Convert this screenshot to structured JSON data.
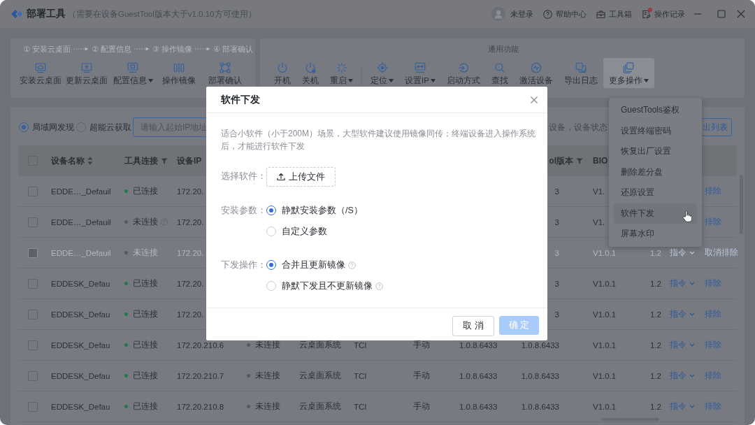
{
  "title_bar": {
    "app_name": "部署工具",
    "note": "（需要在设备GuestTool版本大于v1.0.10方可使用）",
    "user": "未登录",
    "links": [
      {
        "kind": "help",
        "label": "帮助中心",
        "unread": false
      },
      {
        "kind": "toolbox",
        "label": "工具箱",
        "unread": false
      },
      {
        "kind": "log",
        "label": "操作记录",
        "unread": true
      }
    ]
  },
  "deploy": {
    "steps": [
      "① 安装云桌面",
      "② 配置信息",
      "③ 操作镜像",
      "④ 部署确认"
    ],
    "tools": [
      {
        "kind": "install",
        "label": "安装云桌面",
        "dropdown": false
      },
      {
        "kind": "update",
        "label": "更新云桌面",
        "dropdown": false
      },
      {
        "kind": "config",
        "label": "配置信息",
        "dropdown": true
      },
      {
        "kind": "image",
        "label": "操作镜像",
        "dropdown": false
      },
      {
        "kind": "confirm",
        "label": "部署确认",
        "dropdown": false
      }
    ]
  },
  "general": {
    "title": "通用功能",
    "groups": [
      {
        "tools": [
          {
            "kind": "power_on",
            "label": "开机",
            "dropdown": false,
            "expanded": false
          },
          {
            "kind": "power_off",
            "label": "关机",
            "dropdown": false,
            "expanded": false
          },
          {
            "kind": "restart",
            "label": "重启",
            "dropdown": true,
            "expanded": false
          }
        ]
      },
      {
        "tools": [
          {
            "kind": "locate",
            "label": "定位",
            "dropdown": true,
            "expanded": false
          },
          {
            "kind": "ip",
            "label": "设置IP",
            "dropdown": true,
            "expanded": false
          },
          {
            "kind": "boot",
            "label": "启动方式",
            "dropdown": false,
            "expanded": false
          },
          {
            "kind": "find",
            "label": "查找",
            "dropdown": false,
            "expanded": false
          },
          {
            "kind": "activate",
            "label": "激活设备",
            "dropdown": false,
            "expanded": false
          },
          {
            "kind": "export",
            "label": "导出日志",
            "dropdown": false,
            "expanded": false
          },
          {
            "kind": "more",
            "label": "更多操作",
            "dropdown": true,
            "expanded": true
          }
        ]
      }
    ]
  },
  "discovery": {
    "modes": [
      {
        "label": "局域网发现",
        "selected": true
      },
      {
        "label": "超能云获取",
        "selected": false
      }
    ],
    "ip_start": {
      "placeholder": "请输入起始IP地址"
    },
    "hint": "设备，设备状态",
    "export_button": "出列表"
  },
  "table": {
    "select_all": {
      "checked": false
    },
    "columns": {
      "device_name": {
        "label": "设备名称",
        "kind": "sort"
      },
      "tool_connection": {
        "label": "工具连接",
        "kind": "filter"
      },
      "device_ip": {
        "label": "设备IP"
      },
      "column_10": {
        "label": "ol版本",
        "kind": "filter"
      },
      "column_11": {
        "label": "BIO"
      }
    },
    "rows": [
      {
        "checked": false,
        "disabled": false,
        "device_name": "EDDE…_Defauil",
        "tool_connection": {
          "status": "已连接",
          "connected": true,
          "help": false
        },
        "device_ip": "172.20.",
        "column_10": "3",
        "column_11": "V1.",
        "column_14": "排除"
      },
      {
        "checked": false,
        "disabled": false,
        "device_name": "EDDE…_Defauil",
        "tool_connection": {
          "status": "未连接",
          "connected": false,
          "help": true
        },
        "device_ip": "172.20.",
        "column_10": "3",
        "column_11": "V1.",
        "column_14": "排除"
      },
      {
        "checked": false,
        "disabled": true,
        "device_name": "EDDE…_Defauil",
        "tool_connection": {
          "status": "未连接",
          "connected": false,
          "help": false
        },
        "device_ip": "172.20.",
        "column_10": "3",
        "column_11": "V1.0.1",
        "column_12": "1.2",
        "column_13": "指令",
        "column_14": "取消排除"
      },
      {
        "checked": false,
        "disabled": false,
        "device_name": "EDDESK_Defau",
        "tool_connection": {
          "status": "已连接",
          "connected": true,
          "help": false
        },
        "device_ip": "172.20.",
        "column_10": "3",
        "column_11": "V1.0.1",
        "column_12": "1.2",
        "column_13": "指令",
        "column_14": "排除"
      },
      {
        "checked": false,
        "disabled": false,
        "device_name": "EDDESK_Defau",
        "tool_connection": {
          "status": "已连接",
          "connected": true,
          "help": false
        },
        "device_ip": "172.20.",
        "column_10": "3",
        "column_11": "V1.0.1",
        "column_12": "1.2",
        "column_13": "指令",
        "column_14": "排除"
      },
      {
        "checked": false,
        "disabled": false,
        "device_name": "EDDESK_Defau",
        "tool_connection": {
          "status": "已连接",
          "connected": true,
          "help": false
        },
        "device_ip": "172.20.210.6",
        "column_5": {
          "status": "未连接",
          "connected": false,
          "help": false
        },
        "column_6": "云桌面系统",
        "column_7": "TCI",
        "column_8": "手动",
        "column_9": "1.0.8.6433",
        "column_10": "1.0.8.6433",
        "column_11": "V1.0.1",
        "column_12": "1.2",
        "column_13": "指令",
        "column_14": "排除"
      },
      {
        "checked": false,
        "disabled": false,
        "device_name": "EDDESK_Defau",
        "tool_connection": {
          "status": "已连接",
          "connected": true,
          "help": false
        },
        "device_ip": "172.20.210.7",
        "column_5": {
          "status": "未连接",
          "connected": false,
          "help": false
        },
        "column_6": "云桌面系统",
        "column_7": "TCI",
        "column_8": "手动",
        "column_9": "1.0.8.6433",
        "column_10": "1.0.8.6433",
        "column_11": "V1.0.1",
        "column_12": "1.2",
        "column_13": "指令",
        "column_14": "排除"
      },
      {
        "checked": false,
        "disabled": false,
        "device_name": "EDDESK_Defau",
        "tool_connection": {
          "status": "已连接",
          "connected": true,
          "help": false
        },
        "device_ip": "172.20.210.8",
        "column_5": {
          "status": "未连接",
          "connected": false,
          "help": false
        },
        "column_6": "云桌面系统",
        "column_7": "TCI",
        "column_8": "手动",
        "column_9": "1.0.8.6433",
        "column_10": "1.0.8.6433",
        "column_11": "V1.0.1",
        "column_12": "1.2",
        "column_13": "指令",
        "column_14": "排除"
      }
    ]
  },
  "more_menu": {
    "items": [
      {
        "label": "GuestTools鉴权",
        "selected": false
      },
      {
        "label": "设置终端密码",
        "selected": false
      },
      {
        "label": "恢复出厂设置",
        "selected": false
      },
      {
        "label": "删除差分盘",
        "selected": false
      },
      {
        "label": "还原设置",
        "selected": false
      },
      {
        "label": "软件下发",
        "selected": true
      },
      {
        "label": "屏幕水印",
        "selected": false
      }
    ]
  },
  "dialog": {
    "title": "软件下发",
    "description": "适合小软件（小于200M）场景，大型软件建议使用镜像同传；终端设备进入操作系统后，才能进行软件下发",
    "fields": [
      {
        "kind": "upload",
        "label": "选择软件：",
        "button": "上传文件"
      },
      {
        "kind": "radio",
        "label": "安装参数：",
        "options": [
          {
            "label": "静默安装参数（/S）",
            "selected": true,
            "help": false
          },
          {
            "label": "自定义参数",
            "selected": false,
            "help": false
          }
        ]
      },
      {
        "kind": "radio",
        "label": "下发操作：",
        "options": [
          {
            "label": "合并且更新镜像",
            "selected": true,
            "help": true
          },
          {
            "label": "静默下发且不更新镜像",
            "selected": false,
            "help": true
          }
        ]
      }
    ],
    "buttons": [
      {
        "label": "取 消",
        "kind": "default",
        "disabled": false
      },
      {
        "label": "确 定",
        "kind": "primary",
        "disabled": true
      }
    ]
  }
}
